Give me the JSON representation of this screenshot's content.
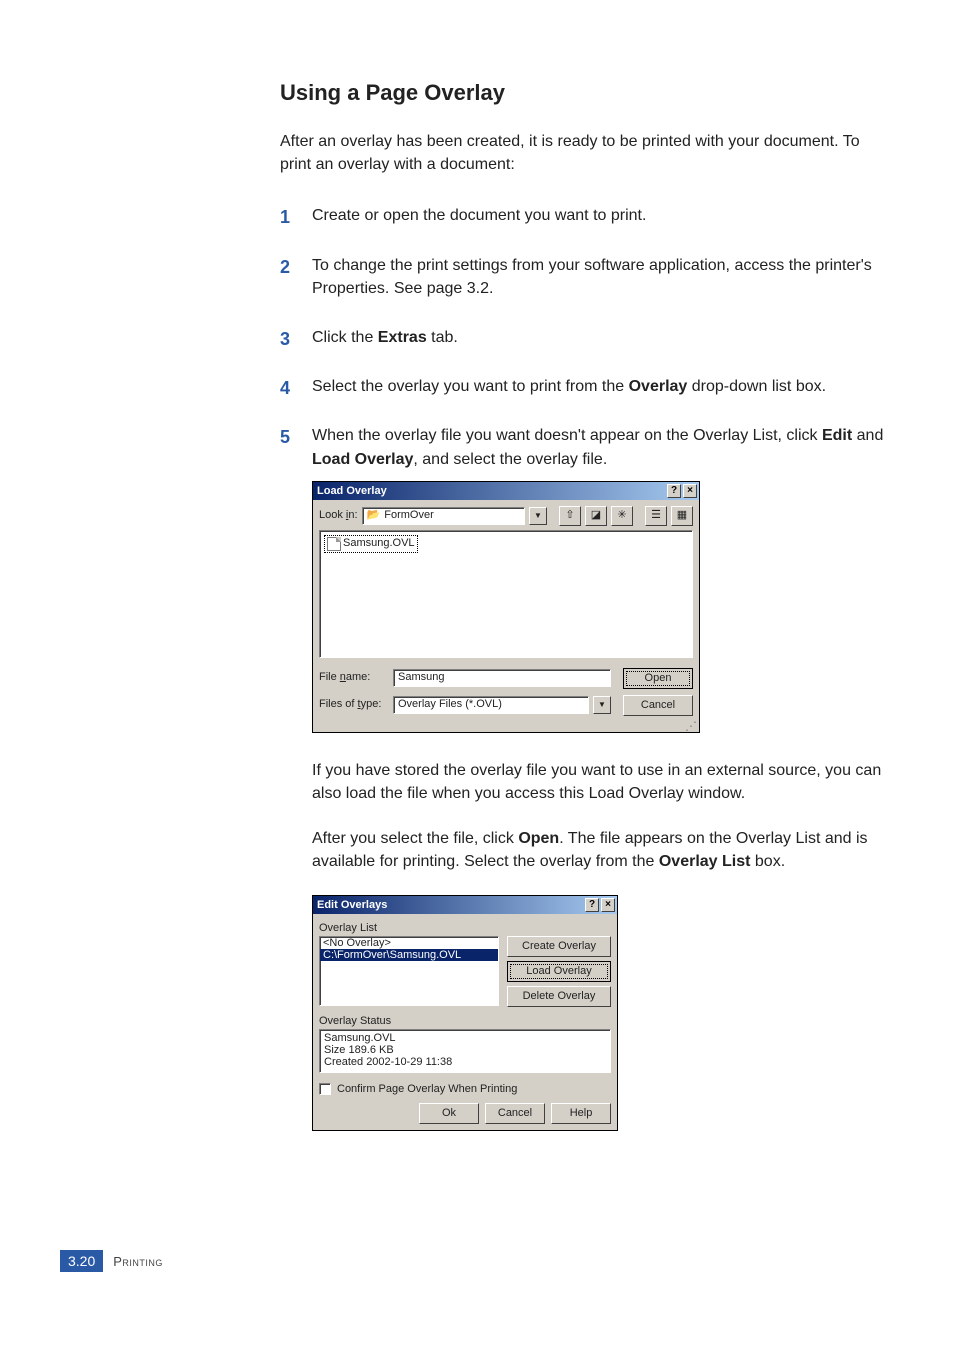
{
  "section_title": "Using a Page Overlay",
  "intro": "After an overlay has been created, it is ready to be printed with your document. To print an overlay with a document:",
  "steps": {
    "s1": "Create or open the document you want to print.",
    "s2a": "To change the print settings from your software application, access the printer's Properties. See ",
    "s2b": "page 3.2",
    "s2c": ".",
    "s3a": "Click the ",
    "s3b": "Extras",
    "s3c": " tab.",
    "s4a": "Select the overlay you want to print from the ",
    "s4b": "Overlay",
    "s4c": " drop-down list box.",
    "s5a": "When the overlay file you want doesn't appear on the Overlay List, click ",
    "s5b": "Edit",
    "s5c": " and ",
    "s5d": "Load Overlay",
    "s5e": ", and select the overlay file."
  },
  "loadDialog": {
    "title": "Load Overlay",
    "help": "?",
    "close": "×",
    "lookin_label": "Look in:",
    "lookin_value": "FormOver",
    "file_item": "Samsung.OVL",
    "filename_label": "File name:",
    "filename_value": "Samsung",
    "filetype_label": "Files of type:",
    "filetype_value": "Overlay Files (*.OVL)",
    "open_btn": "Open",
    "cancel_btn": "Cancel",
    "toolbar": {
      "up": "up-one-level-icon",
      "desktop": "desktop-icon",
      "newfolder": "new-folder-icon",
      "list": "list-view-icon",
      "details": "details-view-icon"
    }
  },
  "paragraphs": {
    "p1": "If you have stored the overlay file you want to use in an external source, you can also load the file when you access this Load Overlay window.",
    "p2a": "After you select the file, click ",
    "p2b": "Open",
    "p2c": ". The file appears on the Overlay List and is available for printing. Select the overlay from the ",
    "p2d": "Overlay List",
    "p2e": " box."
  },
  "editDialog": {
    "title": "Edit Overlays",
    "help": "?",
    "close": "×",
    "list_label": "Overlay List",
    "list_items": [
      "<No Overlay>",
      "C:\\FormOver\\Samsung.OVL"
    ],
    "create_btn": "Create Overlay",
    "load_btn": "Load Overlay",
    "delete_btn": "Delete Overlay",
    "status_label": "Overlay Status",
    "status_lines": [
      "Samsung.OVL",
      "Size 189.6 KB",
      "Created 2002-10-29 11:38"
    ],
    "confirm_label": "Confirm Page Overlay When Printing",
    "ok_btn": "Ok",
    "cancel_btn": "Cancel",
    "help_btn": "Help"
  },
  "footer": {
    "page": "3.20",
    "section": "Printing"
  }
}
